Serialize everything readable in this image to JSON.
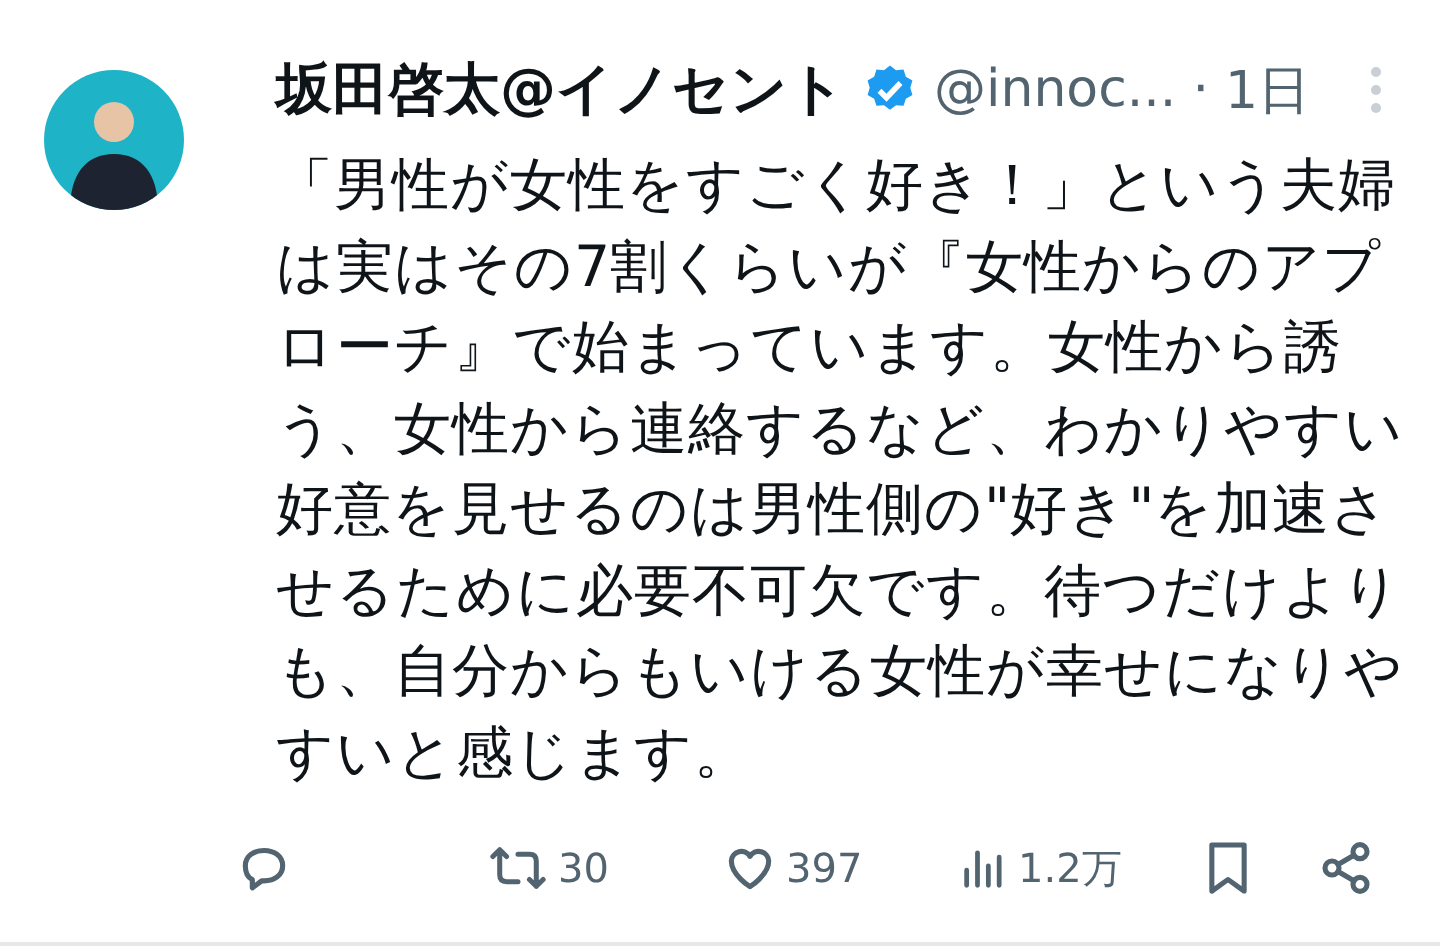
{
  "tweet": {
    "display_name": "坂田啓太@イノセント",
    "verified": true,
    "handle": "@innoc...",
    "separator": "·",
    "time": "1日",
    "text": "「男性が女性をすごく好き！」という夫婦は実はその7割くらいが『女性からのアプローチ』で始まっています。女性から誘う、女性から連絡するなど、わかりやすい好意を見せるのは男性側の\"好き\"を加速させるために必要不可欠です。待つだけよりも、自分からもいける女性が幸せになりやすいと感じます。",
    "actions": [
      {
        "kind": "reply"
      },
      {
        "kind": "retweet",
        "count": "30"
      },
      {
        "kind": "like",
        "count": "397"
      },
      {
        "kind": "views",
        "count": "1.2万"
      },
      {
        "kind": "bookmark"
      },
      {
        "kind": "share"
      }
    ]
  }
}
